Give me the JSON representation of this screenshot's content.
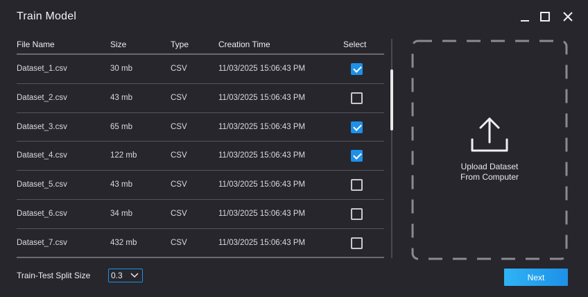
{
  "window": {
    "title": "Train Model"
  },
  "table": {
    "headers": {
      "name": "File Name",
      "size": "Size",
      "type": "Type",
      "time": "Creation Time",
      "select": "Select"
    },
    "rows": [
      {
        "name": "Dataset_1.csv",
        "size": "30 mb",
        "type": "CSV",
        "time": "11/03/2025 15:06:43 PM",
        "selected": true
      },
      {
        "name": "Dataset_2.csv",
        "size": "43 mb",
        "type": "CSV",
        "time": "11/03/2025 15:06:43 PM",
        "selected": false
      },
      {
        "name": "Dataset_3.csv",
        "size": "65 mb",
        "type": "CSV",
        "time": "11/03/2025 15:06:43 PM",
        "selected": true
      },
      {
        "name": "Dataset_4.csv",
        "size": "122 mb",
        "type": "CSV",
        "time": "11/03/2025 15:06:43 PM",
        "selected": true
      },
      {
        "name": "Dataset_5.csv",
        "size": "43 mb",
        "type": "CSV",
        "time": "11/03/2025 15:06:43 PM",
        "selected": false
      },
      {
        "name": "Dataset_6.csv",
        "size": "34 mb",
        "type": "CSV",
        "time": "11/03/2025 15:06:43 PM",
        "selected": false
      },
      {
        "name": "Dataset_7.csv",
        "size": "432 mb",
        "type": "CSV",
        "time": "11/03/2025 15:06:43 PM",
        "selected": false
      }
    ]
  },
  "upload": {
    "line1": "Upload Dataset",
    "line2": "From Computer",
    "icon": "upload-icon"
  },
  "split": {
    "label": "Train-Test Split Size",
    "value": "0.3"
  },
  "actions": {
    "next_label": "Next"
  },
  "colors": {
    "accent": "#1e90e8",
    "background": "#26262c",
    "text": "#e6e6ea"
  }
}
